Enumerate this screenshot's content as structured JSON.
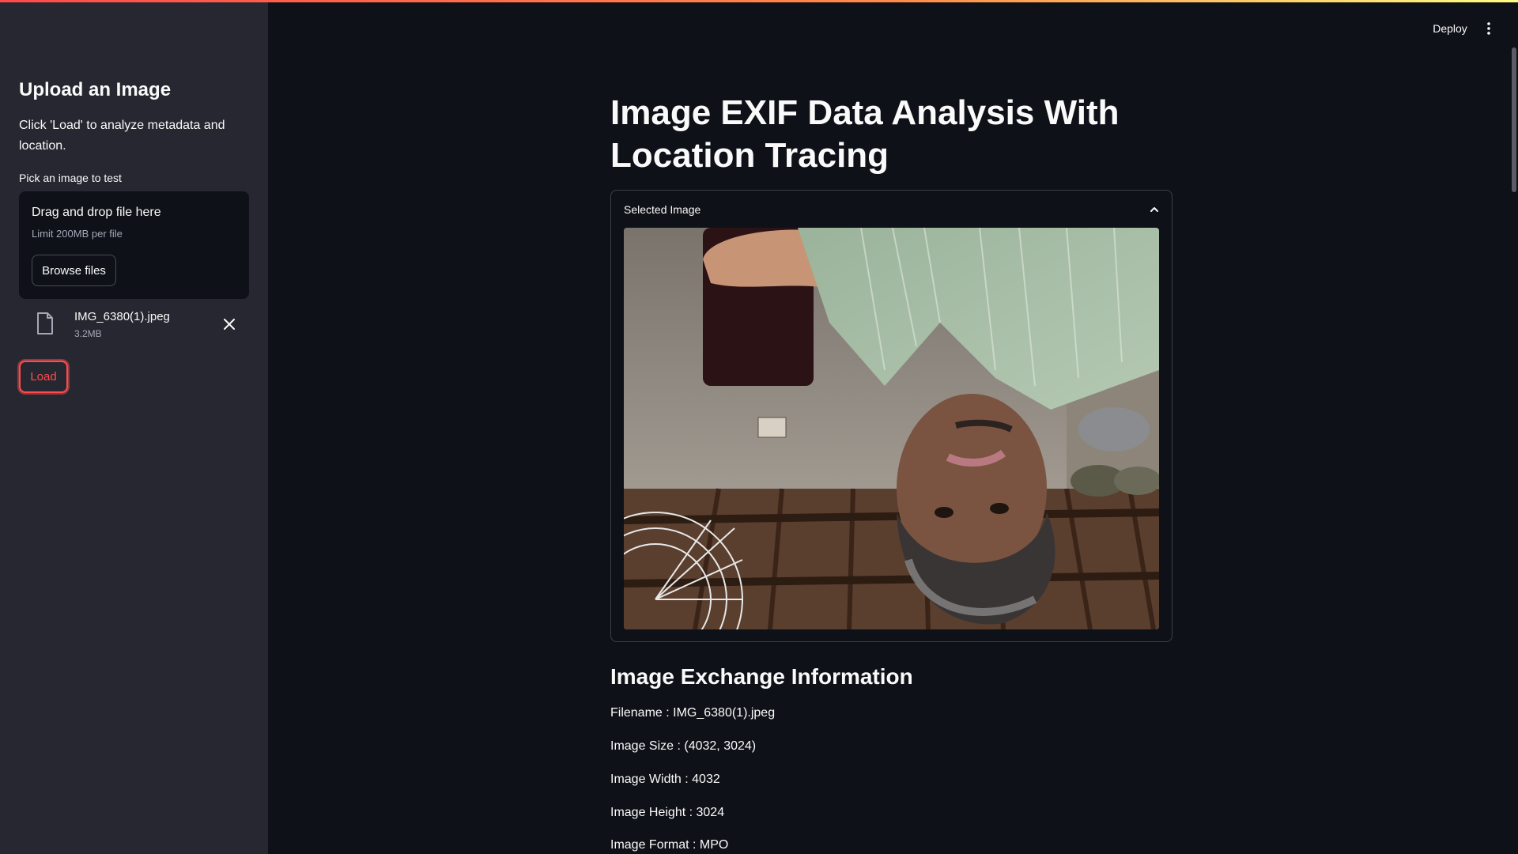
{
  "sidebar": {
    "title": "Upload an Image",
    "description": "Click 'Load' to analyze metadata and location.",
    "uploader_label": "Pick an image to test",
    "dropzone": {
      "title": "Drag and drop file here",
      "limit": "Limit 200MB per file",
      "browse_label": "Browse files"
    },
    "uploaded_file": {
      "name": "IMG_6380(1).jpeg",
      "size": "3.2MB"
    },
    "load_label": "Load"
  },
  "header": {
    "deploy_label": "Deploy",
    "menu_icon": "kebab-menu-icon"
  },
  "main": {
    "title": "Image EXIF Data Analysis With Location Tracing",
    "expander": {
      "label": "Selected Image",
      "expanded": true
    },
    "section_title": "Image Exchange Information",
    "info": [
      "Filename : IMG_6380(1).jpeg",
      "Image Size : (4032, 3024)",
      "Image Width : 4032",
      "Image Height : 3024",
      "Image Format : MPO"
    ]
  },
  "colors": {
    "background": "#0e1117",
    "sidebar": "#262730",
    "accent": "#ff4b4b",
    "text": "#fafafa"
  }
}
